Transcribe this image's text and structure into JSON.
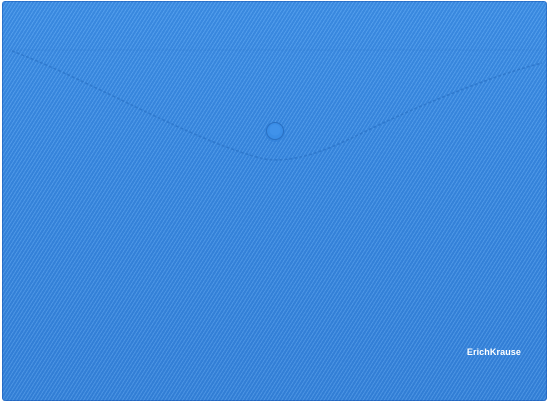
{
  "product": {
    "brand_logo_text": "ErichKrause",
    "folder_color": "#3d8fe6",
    "seam_color": "#2c74c8",
    "button_color": "#3a8de6"
  }
}
